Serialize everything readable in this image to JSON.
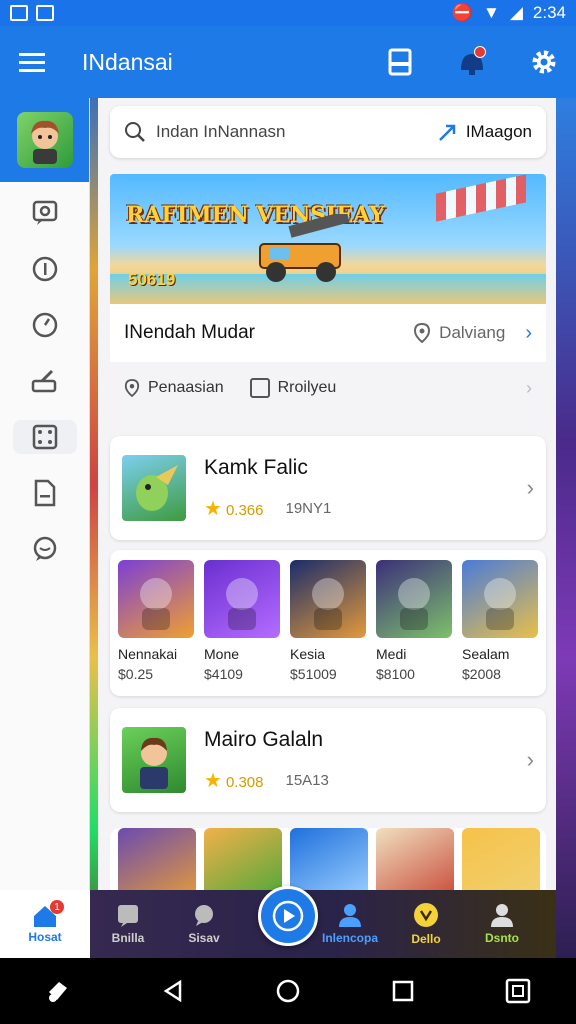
{
  "status_bar": {
    "time": "2:34"
  },
  "app_bar": {
    "title": "INdansai"
  },
  "search": {
    "placeholder": "Indan InNannasn",
    "map_label": "IMaagon"
  },
  "banner": {
    "logo_text": "RAFIMEN VENSIEAY",
    "number": "50619",
    "title": "INendah Mudar",
    "location": "Dalviang"
  },
  "filters": {
    "location_label": "Penaasian",
    "checkbox_label": "Rroilyeu"
  },
  "games": [
    {
      "name": "Kamk Falic",
      "rating": "0.366",
      "code": "19NY1"
    },
    {
      "name": "Mairo Galaln",
      "rating": "0.308",
      "code": "15A13"
    }
  ],
  "grid": [
    {
      "name": "Nennakai",
      "price": "$0.25",
      "colors": [
        "#7b3fd6",
        "#f0a030"
      ]
    },
    {
      "name": "Mone",
      "price": "$4109",
      "colors": [
        "#6a2fd0",
        "#b56cff"
      ]
    },
    {
      "name": "Kesia",
      "price": "$51009",
      "colors": [
        "#1a2c6b",
        "#e39a3a"
      ]
    },
    {
      "name": "Medi",
      "price": "$8100",
      "colors": [
        "#3b2f7a",
        "#7ec06c"
      ]
    },
    {
      "name": "Sealam",
      "price": "$2008",
      "colors": [
        "#4a7bd8",
        "#e8c04a"
      ]
    }
  ],
  "strip_colors": [
    [
      "#6a4bb0",
      "#e39a3a"
    ],
    [
      "#f3b04a",
      "#4fa83a"
    ],
    [
      "#1f6fdc",
      "#9bd0ff"
    ],
    [
      "#f0e0c0",
      "#c94b3a"
    ],
    [
      "#f6c24a",
      "#f0d070"
    ]
  ],
  "bottom_nav": {
    "home": "Hosat",
    "home_badge": "1",
    "items": [
      {
        "label": "Bnilla",
        "color": "#cfcfcf"
      },
      {
        "label": "Sisav",
        "color": "#cfcfcf"
      },
      {
        "label": "Inlencopa",
        "color": "#4aa0ff"
      },
      {
        "label": "Dello",
        "color": "#f4d23a"
      },
      {
        "label": "Dsnto",
        "color": "#a8e04a"
      }
    ]
  },
  "icons": {
    "menu": "menu-icon",
    "clipboard": "clipboard-icon",
    "notifications": "notification-icon",
    "settings": "gear-icon",
    "search": "search-icon",
    "map": "navigation-arrow-icon",
    "pin": "location-pin-icon",
    "play": "play-icon"
  }
}
